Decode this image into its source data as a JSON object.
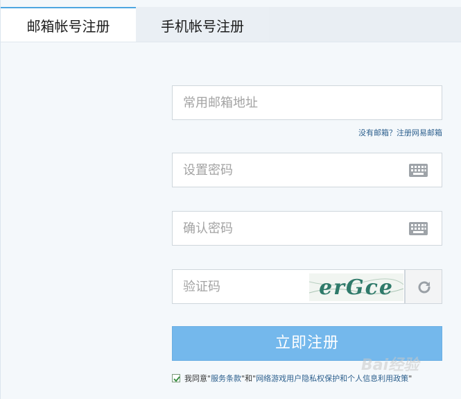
{
  "tabs": {
    "email_label": "邮箱帐号注册",
    "phone_label": "手机帐号注册"
  },
  "form": {
    "email_placeholder": "常用邮箱地址",
    "no_email_link": "没有邮箱？注册网易邮箱",
    "password_placeholder": "设置密码",
    "confirm_placeholder": "确认密码",
    "captcha_placeholder": "验证码",
    "captcha_text": "erGce",
    "submit_label": "立即注册"
  },
  "agreement": {
    "checked": true,
    "prefix": "我同意\"",
    "terms_link": "服务条款",
    "middle": "\"和\"",
    "privacy_link": "网络游戏用户隐私权保护和个人信息利用政策",
    "suffix": "\""
  },
  "watermark": {
    "text": "Bai经验"
  },
  "icons": {
    "keyboard": "keyboard-icon",
    "refresh": "refresh-icon",
    "checkmark": "checkmark-icon"
  },
  "colors": {
    "accent": "#4ea6e0",
    "submit_bg": "#74b8ec",
    "link": "#2c5f8d",
    "page_bg": "#f4f8fb"
  }
}
